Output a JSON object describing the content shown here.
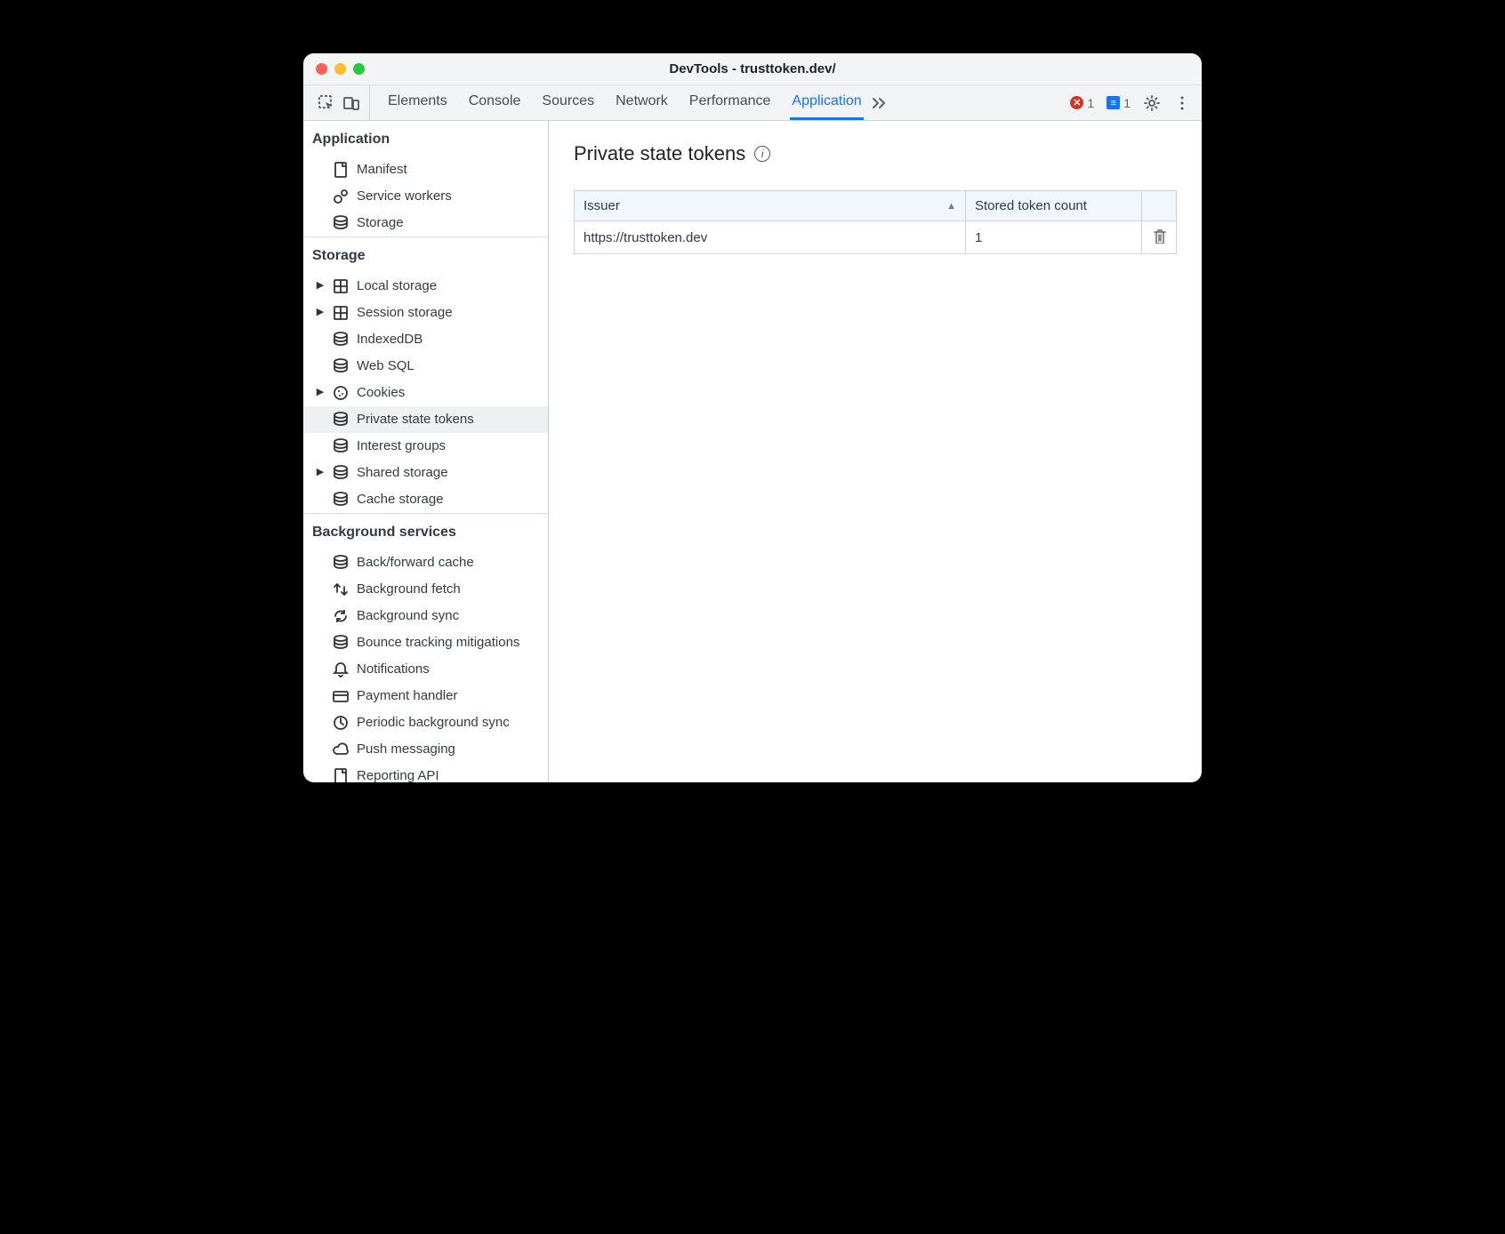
{
  "window": {
    "title": "DevTools - trusttoken.dev/"
  },
  "tabstrip": {
    "tabs": [
      "Elements",
      "Console",
      "Sources",
      "Network",
      "Performance",
      "Application"
    ],
    "active": "Application",
    "error_count": "1",
    "message_count": "1"
  },
  "sidebar": {
    "sections": [
      {
        "title": "Application",
        "items": [
          {
            "label": "Manifest",
            "icon": "page-icon",
            "expandable": false,
            "selected": false
          },
          {
            "label": "Service workers",
            "icon": "gears-icon",
            "expandable": false,
            "selected": false
          },
          {
            "label": "Storage",
            "icon": "db-icon",
            "expandable": false,
            "selected": false
          }
        ]
      },
      {
        "title": "Storage",
        "items": [
          {
            "label": "Local storage",
            "icon": "grid-icon",
            "expandable": true,
            "selected": false
          },
          {
            "label": "Session storage",
            "icon": "grid-icon",
            "expandable": true,
            "selected": false
          },
          {
            "label": "IndexedDB",
            "icon": "db-icon",
            "expandable": false,
            "selected": false
          },
          {
            "label": "Web SQL",
            "icon": "db-icon",
            "expandable": false,
            "selected": false
          },
          {
            "label": "Cookies",
            "icon": "cookie-icon",
            "expandable": true,
            "selected": false
          },
          {
            "label": "Private state tokens",
            "icon": "db-icon",
            "expandable": false,
            "selected": true
          },
          {
            "label": "Interest groups",
            "icon": "db-icon",
            "expandable": false,
            "selected": false
          },
          {
            "label": "Shared storage",
            "icon": "db-icon",
            "expandable": true,
            "selected": false
          },
          {
            "label": "Cache storage",
            "icon": "db-icon",
            "expandable": false,
            "selected": false
          }
        ]
      },
      {
        "title": "Background services",
        "items": [
          {
            "label": "Back/forward cache",
            "icon": "db-icon",
            "expandable": false,
            "selected": false
          },
          {
            "label": "Background fetch",
            "icon": "swap-icon",
            "expandable": false,
            "selected": false
          },
          {
            "label": "Background sync",
            "icon": "sync-icon",
            "expandable": false,
            "selected": false
          },
          {
            "label": "Bounce tracking mitigations",
            "icon": "db-icon",
            "expandable": false,
            "selected": false
          },
          {
            "label": "Notifications",
            "icon": "bell-icon",
            "expandable": false,
            "selected": false
          },
          {
            "label": "Payment handler",
            "icon": "card-icon",
            "expandable": false,
            "selected": false
          },
          {
            "label": "Periodic background sync",
            "icon": "clock-icon",
            "expandable": false,
            "selected": false
          },
          {
            "label": "Push messaging",
            "icon": "cloud-icon",
            "expandable": false,
            "selected": false
          },
          {
            "label": "Reporting API",
            "icon": "page-icon",
            "expandable": false,
            "selected": false
          }
        ]
      }
    ]
  },
  "main": {
    "heading": "Private state tokens",
    "columns": {
      "issuer": "Issuer",
      "count": "Stored token count"
    },
    "rows": [
      {
        "issuer": "https://trusttoken.dev",
        "count": "1"
      }
    ]
  }
}
